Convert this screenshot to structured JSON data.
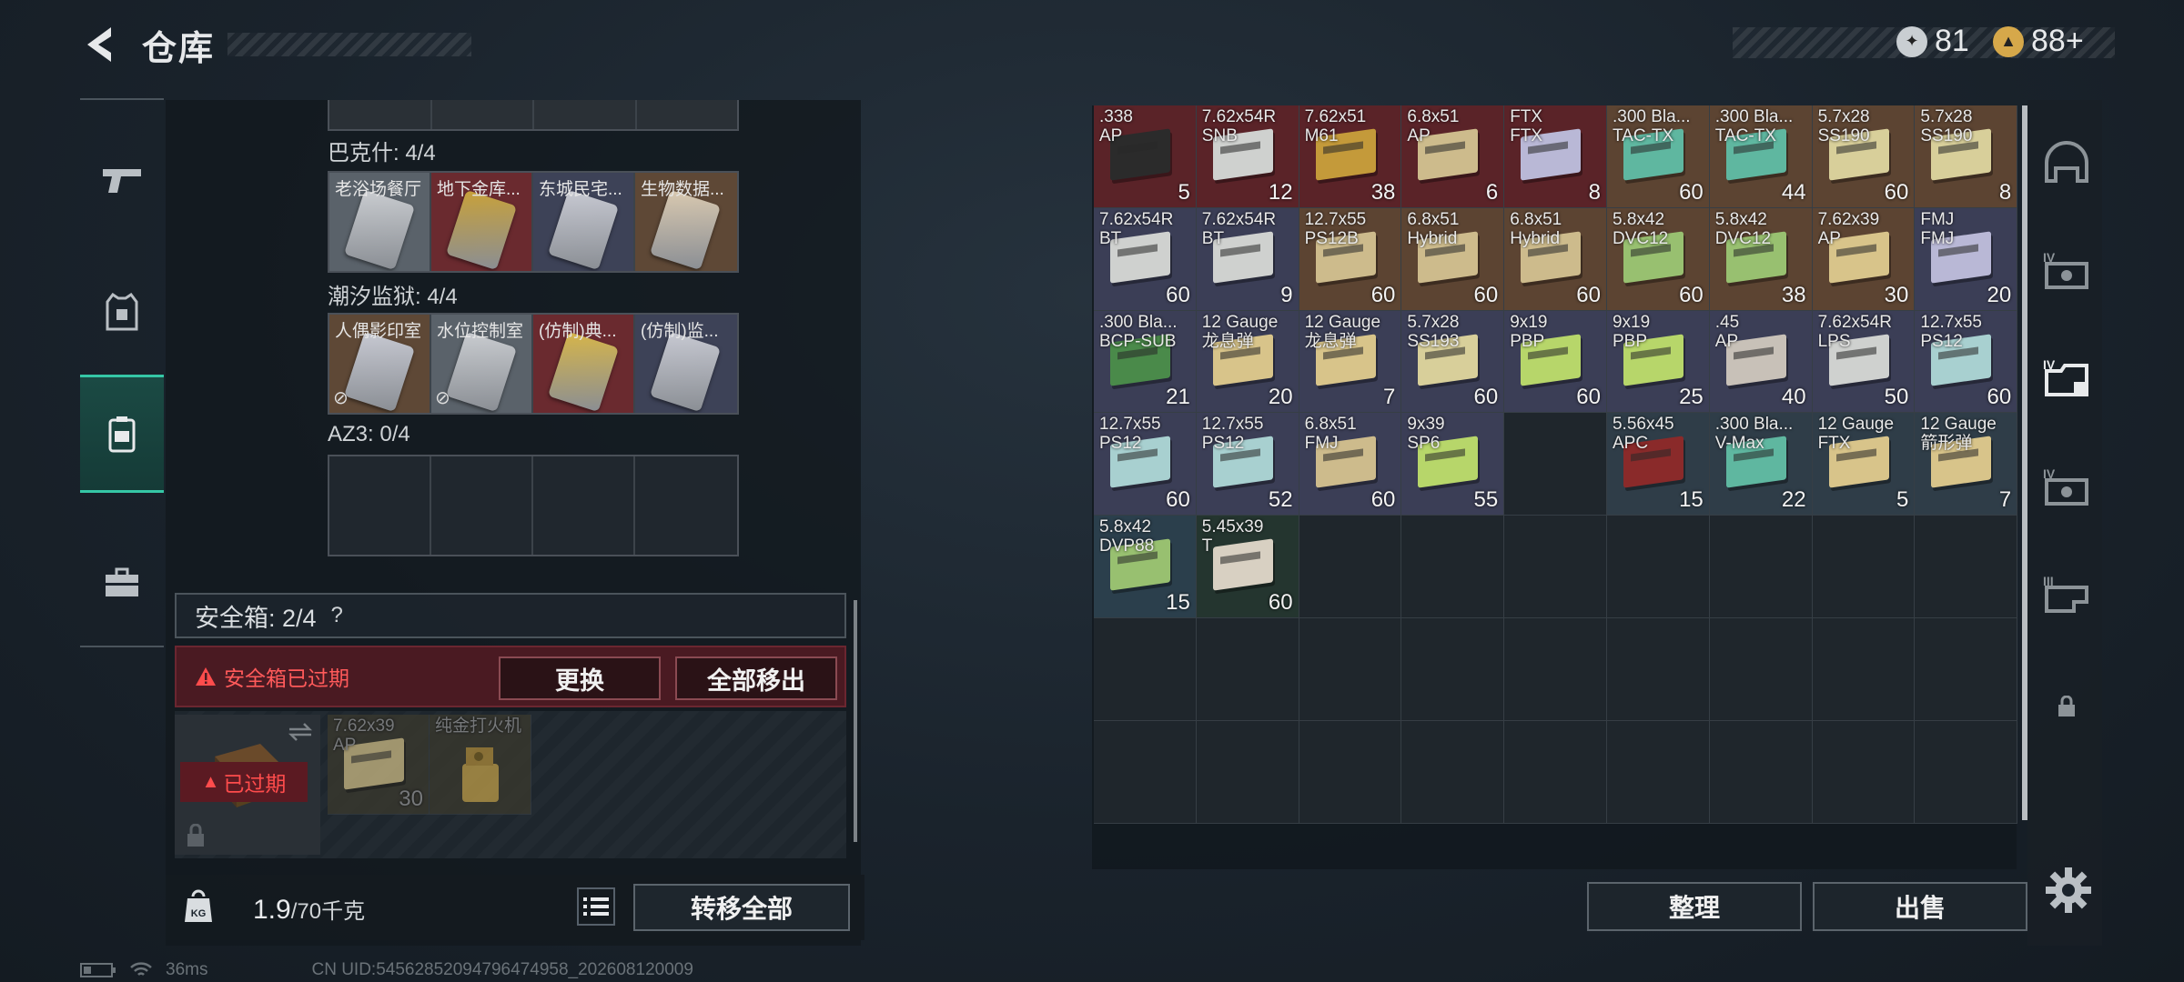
{
  "header": {
    "title": "仓库",
    "currency_silver": "81",
    "currency_gold": "88+"
  },
  "left_panel": {
    "group1": {
      "label": "巴克什: 4/4",
      "cards": [
        {
          "label": "老浴场餐厅",
          "color": "#5a626a",
          "card": "#c9ccd0"
        },
        {
          "label": "地下金库...",
          "color": "#6a2a2f",
          "card": "#c8a13a"
        },
        {
          "label": "东城民宅...",
          "color": "#3d4257",
          "card": "#c7c9d2"
        },
        {
          "label": "生物数据...",
          "color": "#5e4836",
          "card": "#d9c9b0"
        }
      ]
    },
    "group2": {
      "label": "潮汐监狱: 4/4",
      "cards": [
        {
          "label": "人偶影印室",
          "color": "#5e4836",
          "card": "#c7c9d2",
          "nouse": true
        },
        {
          "label": "水位控制室",
          "color": "#5a626a",
          "card": "#c9ccd0",
          "nouse": true
        },
        {
          "label": "(仿制)典...",
          "color": "#6a2a2f",
          "card": "#d6b54a"
        },
        {
          "label": "(仿制)监...",
          "color": "#3d4257",
          "card": "#c7c9d2"
        }
      ]
    },
    "group3": {
      "label": "AZ3: 0/4"
    },
    "safebox": {
      "label": "安全箱: 2/4",
      "help": "?",
      "warning": "安全箱已过期",
      "replace_btn": "更换",
      "remove_all_btn": "全部移出",
      "expired_badge": "已过期",
      "items": [
        {
          "name": "7.62x39\nAP",
          "qty": "30"
        },
        {
          "name": "纯金打火机",
          "qty": ""
        }
      ]
    },
    "weight": {
      "current": "1.9",
      "max": "/70千克"
    },
    "transfer_all": "转移全部"
  },
  "status": {
    "ping": "36ms",
    "uid": "CN UID:54562852094796474958_202608120009"
  },
  "grid": {
    "columns": 9,
    "items": [
      {
        "name": ".338\nAP",
        "qty": "5",
        "bg": "#5a2328",
        "box": "#2b2b2b"
      },
      {
        "name": "7.62x54R\nSNB",
        "qty": "12",
        "bg": "#5a2328",
        "box": "#cfd1cf"
      },
      {
        "name": "7.62x51\nM61",
        "qty": "38",
        "bg": "#5a2328",
        "box": "#c49a3a"
      },
      {
        "name": "6.8x51\nAP",
        "qty": "6",
        "bg": "#5a2328",
        "box": "#cdbb8c"
      },
      {
        "name": "FTX\nFTX",
        "qty": "8",
        "bg": "#5a2328",
        "box": "#b9b8d6"
      },
      {
        "name": ".300 Bla...\nTAC-TX",
        "qty": "60",
        "bg": "#5c4432",
        "box": "#5fb7a0"
      },
      {
        "name": ".300 Bla...\nTAC-TX",
        "qty": "44",
        "bg": "#5c4432",
        "box": "#5fb7a0"
      },
      {
        "name": "5.7x28\nSS190",
        "qty": "60",
        "bg": "#5c4432",
        "box": "#d8cf9a"
      },
      {
        "name": "5.7x28\nSS190",
        "qty": "8",
        "bg": "#5c4432",
        "box": "#d8cf9a"
      },
      {
        "name": "7.62x54R\nBT",
        "qty": "60",
        "bg": "#3b3e56",
        "box": "#cfd1cf"
      },
      {
        "name": "7.62x54R\nBT",
        "qty": "9",
        "bg": "#3b3e56",
        "box": "#cfd1cf"
      },
      {
        "name": "12.7x55\nPS12B",
        "qty": "60",
        "bg": "#5c4432",
        "box": "#cdbb8c"
      },
      {
        "name": "6.8x51\nHybrid",
        "qty": "60",
        "bg": "#5c4432",
        "box": "#cdbb8c"
      },
      {
        "name": "6.8x51\nHybrid",
        "qty": "60",
        "bg": "#5c4432",
        "box": "#cdbb8c"
      },
      {
        "name": "5.8x42\nDVC12",
        "qty": "60",
        "bg": "#5c4432",
        "box": "#98c070"
      },
      {
        "name": "5.8x42\nDVC12",
        "qty": "38",
        "bg": "#5c4432",
        "box": "#98c070"
      },
      {
        "name": "7.62x39\nAP",
        "qty": "30",
        "bg": "#5c4432",
        "box": "#d8c48a"
      },
      {
        "name": "FMJ\nFMJ",
        "qty": "20",
        "bg": "#3b3e56",
        "box": "#b9b8d6"
      },
      {
        "name": ".300 Bla...\nBCP-SUB",
        "qty": "21",
        "bg": "#3b3e56",
        "box": "#4a8a4a"
      },
      {
        "name": "12 Gauge\n龙息弹",
        "qty": "20",
        "bg": "#3b3e56",
        "box": "#d8c48a"
      },
      {
        "name": "12 Gauge\n龙息弹",
        "qty": "7",
        "bg": "#3b3e56",
        "box": "#d8c48a"
      },
      {
        "name": "5.7x28\nSS193",
        "qty": "60",
        "bg": "#3b3e56",
        "box": "#d8cf9a"
      },
      {
        "name": "9x19\nPBP",
        "qty": "60",
        "bg": "#3b3e56",
        "box": "#b7d66a"
      },
      {
        "name": "9x19\nPBP",
        "qty": "25",
        "bg": "#3b3e56",
        "box": "#b7d66a"
      },
      {
        "name": ".45\nAP",
        "qty": "40",
        "bg": "#3b3e56",
        "box": "#c8c1b8"
      },
      {
        "name": "7.62x54R\nLPS",
        "qty": "50",
        "bg": "#3b3e56",
        "box": "#cfd1cf"
      },
      {
        "name": "12.7x55\nPS12",
        "qty": "60",
        "bg": "#3b3e56",
        "box": "#a8d0d0"
      },
      {
        "name": "12.7x55\nPS12",
        "qty": "60",
        "bg": "#3b3e56",
        "box": "#a8d0d0"
      },
      {
        "name": "12.7x55\nPS12",
        "qty": "52",
        "bg": "#3b3e56",
        "box": "#a8d0d0"
      },
      {
        "name": "6.8x51\nFMJ",
        "qty": "60",
        "bg": "#3b3e56",
        "box": "#cdbb8c"
      },
      {
        "name": "9x39\nSP6",
        "qty": "55",
        "bg": "#3b3e56",
        "box": "#b7d66a"
      },
      {
        "empty": true
      },
      {
        "name": "5.56x45\nAPC",
        "qty": "15",
        "bg": "#2f3d48",
        "box": "#8a2a2a"
      },
      {
        "name": ".300 Bla...\nV-Max",
        "qty": "22",
        "bg": "#2f3d48",
        "box": "#5fb7a0"
      },
      {
        "name": "12 Gauge\nFTX",
        "qty": "5",
        "bg": "#2f3d48",
        "box": "#d8c48a"
      },
      {
        "name": "12 Gauge\n箭形弹",
        "qty": "7",
        "bg": "#2f3d48",
        "box": "#d8c48a"
      },
      {
        "name": "5.8x42\nDVP88",
        "qty": "15",
        "bg": "#2b3f4c",
        "box": "#98c070"
      },
      {
        "name": "5.45x39\nT",
        "qty": "60",
        "bg": "#24352f",
        "box": "#d8d0c2"
      }
    ],
    "total_rows": 7
  },
  "buttons": {
    "sort": "整理",
    "sell": "出售"
  },
  "right_rail": [
    "helmet-icon",
    "armor-iv-icon",
    "chest-rig-iv-icon",
    "backpack-iv-icon",
    "armor-iii-icon",
    "lock-icon"
  ]
}
